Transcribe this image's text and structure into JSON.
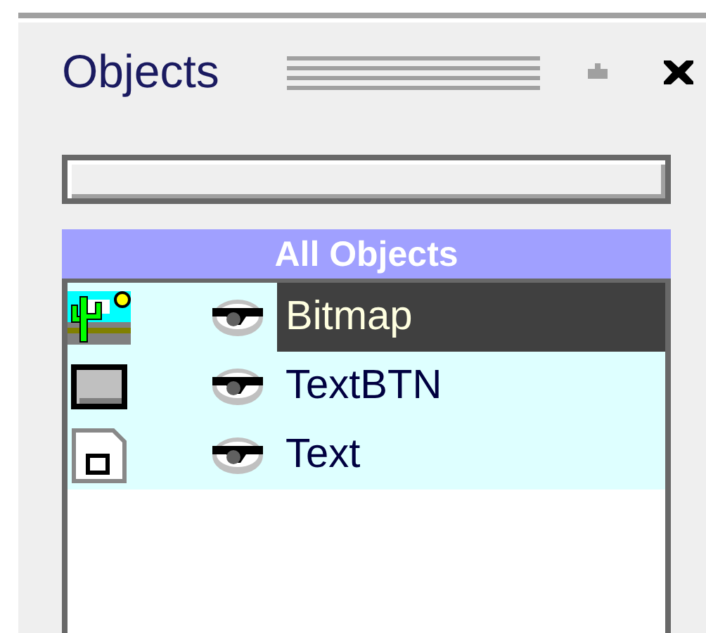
{
  "panel": {
    "title": "Objects"
  },
  "list": {
    "header": "All Objects",
    "rows": [
      {
        "name": "Bitmap",
        "kind": "bitmap",
        "visible": true,
        "selected": true
      },
      {
        "name": "TextBTN",
        "kind": "button",
        "visible": true,
        "selected": false
      },
      {
        "name": "Text",
        "kind": "text",
        "visible": true,
        "selected": false
      }
    ]
  }
}
